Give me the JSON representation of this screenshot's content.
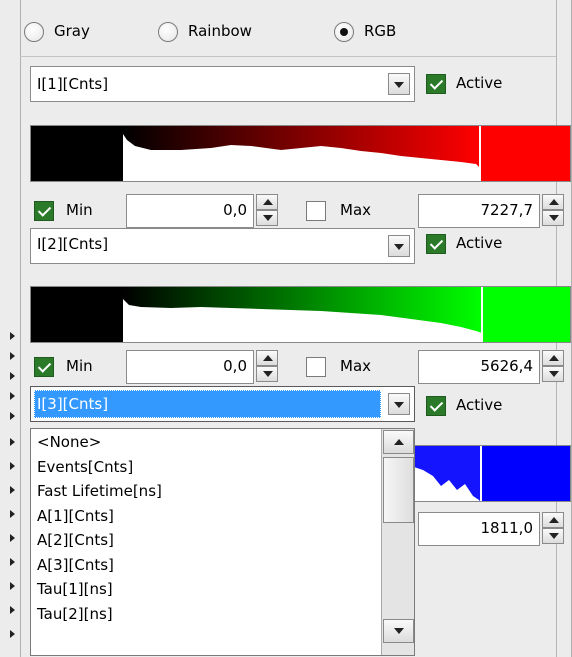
{
  "palette_modes": [
    {
      "label": "Gray",
      "selected": false
    },
    {
      "label": "Rainbow",
      "selected": false
    },
    {
      "label": "RGB",
      "selected": true
    }
  ],
  "channels": [
    {
      "source": "I[1][Cnts]",
      "active_label": "Active",
      "min_label": "Min",
      "min_value": "0,0",
      "min_checked": true,
      "max_label": "Max",
      "max_value": "7227,7",
      "max_checked": false,
      "color": "#ff0000"
    },
    {
      "source": "I[2][Cnts]",
      "active_label": "Active",
      "min_label": "Min",
      "min_value": "0,0",
      "min_checked": true,
      "max_label": "Max",
      "max_value": "5626,4",
      "max_checked": false,
      "color": "#00ff00"
    },
    {
      "source": "I[3][Cnts]",
      "active_label": "Active",
      "max_value": "1811,0",
      "color": "#0000ff"
    }
  ],
  "dropdown_list": {
    "items": [
      "<None>",
      "Events[Cnts]",
      "Fast Lifetime[ns]",
      "A[1][Cnts]",
      "A[2][Cnts]",
      "A[3][Cnts]",
      "Tau[1][ns]",
      "Tau[2][ns]"
    ]
  },
  "colors": {
    "selection": "#3399ff",
    "check_green": "#2a7a2a"
  }
}
